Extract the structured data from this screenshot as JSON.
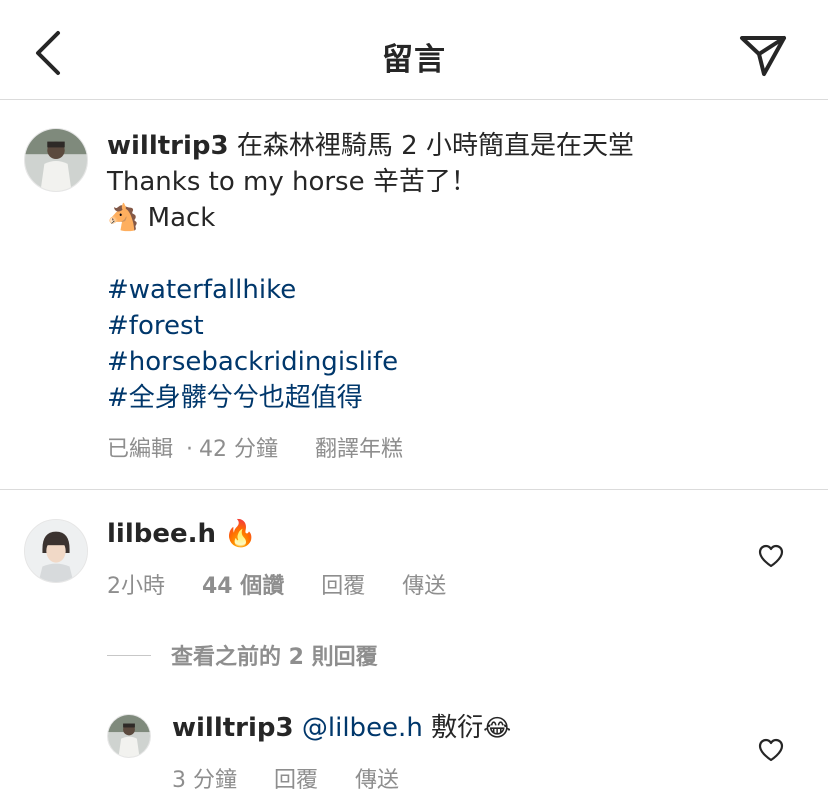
{
  "header": {
    "title": "留言",
    "back_icon": "chevron-left-icon",
    "send_icon": "paper-plane-icon"
  },
  "caption": {
    "username": "willtrip3",
    "text_line1": "在森林裡騎馬 2 小時簡直是在天堂",
    "text_line2": "Thanks to my horse 辛苦了！",
    "horse_emoji": "🐴",
    "horse_name": "Mack",
    "hashtags": [
      "#waterfallhike",
      "#forest",
      "#horsebackridingislife",
      "#全身髒兮兮也超值得"
    ],
    "edited": "已編輯",
    "separator": "·",
    "time": "42 分鐘",
    "translate": "翻譯年糕"
  },
  "comment": {
    "username": "lilbee.h",
    "emoji": "🔥",
    "time": "2小時",
    "likes": "44 個讚",
    "reply": "回覆",
    "share": "傳送"
  },
  "view_replies": "查看之前的 2 則回覆",
  "reply": {
    "username": "willtrip3",
    "mention": "@lilbee.h",
    "text": "敷衍",
    "emoji": "😂",
    "time": "3 分鐘",
    "reply": "回覆",
    "share": "傳送"
  },
  "colors": {
    "text": "#262626",
    "secondary": "#8e8e8e",
    "link": "#00376b",
    "divider": "#dbdbdb"
  }
}
